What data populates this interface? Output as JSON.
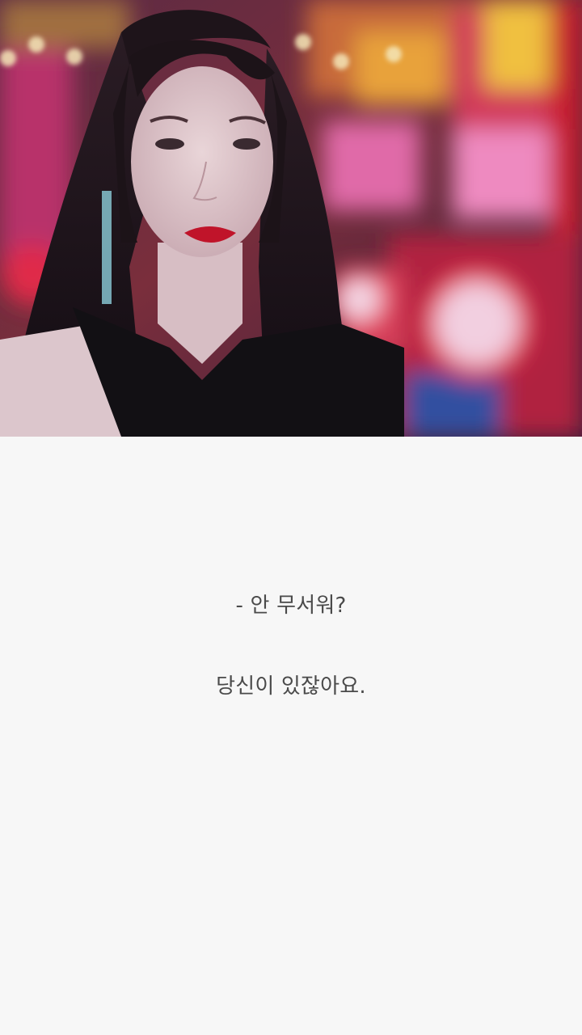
{
  "post": {
    "photo_icon": "portrait-photo",
    "lines": [
      "- 안 무서워?",
      "당신이 있잖아요."
    ]
  },
  "colors": {
    "page_background": "#f7f7f7",
    "text": "#4a4a4a"
  }
}
